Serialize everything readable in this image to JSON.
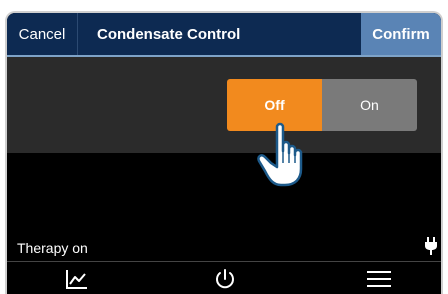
{
  "header": {
    "cancel_label": "Cancel",
    "title": "Condensate Control",
    "confirm_label": "Confirm"
  },
  "toggle": {
    "off_label": "Off",
    "on_label": "On",
    "selected": "Off"
  },
  "status": {
    "therapy_text": "Therapy on"
  },
  "icons": {
    "power": "power-plug-icon",
    "trend": "trend-chart-icon",
    "power_button": "power-button-icon",
    "menu": "hamburger-menu-icon",
    "hand": "pointing-hand-icon"
  },
  "colors": {
    "header_bg": "#0d2a52",
    "confirm_bg": "#5a84b5",
    "toggle_selected": "#f28a1e",
    "toggle_unselected": "#7a7a7a"
  }
}
